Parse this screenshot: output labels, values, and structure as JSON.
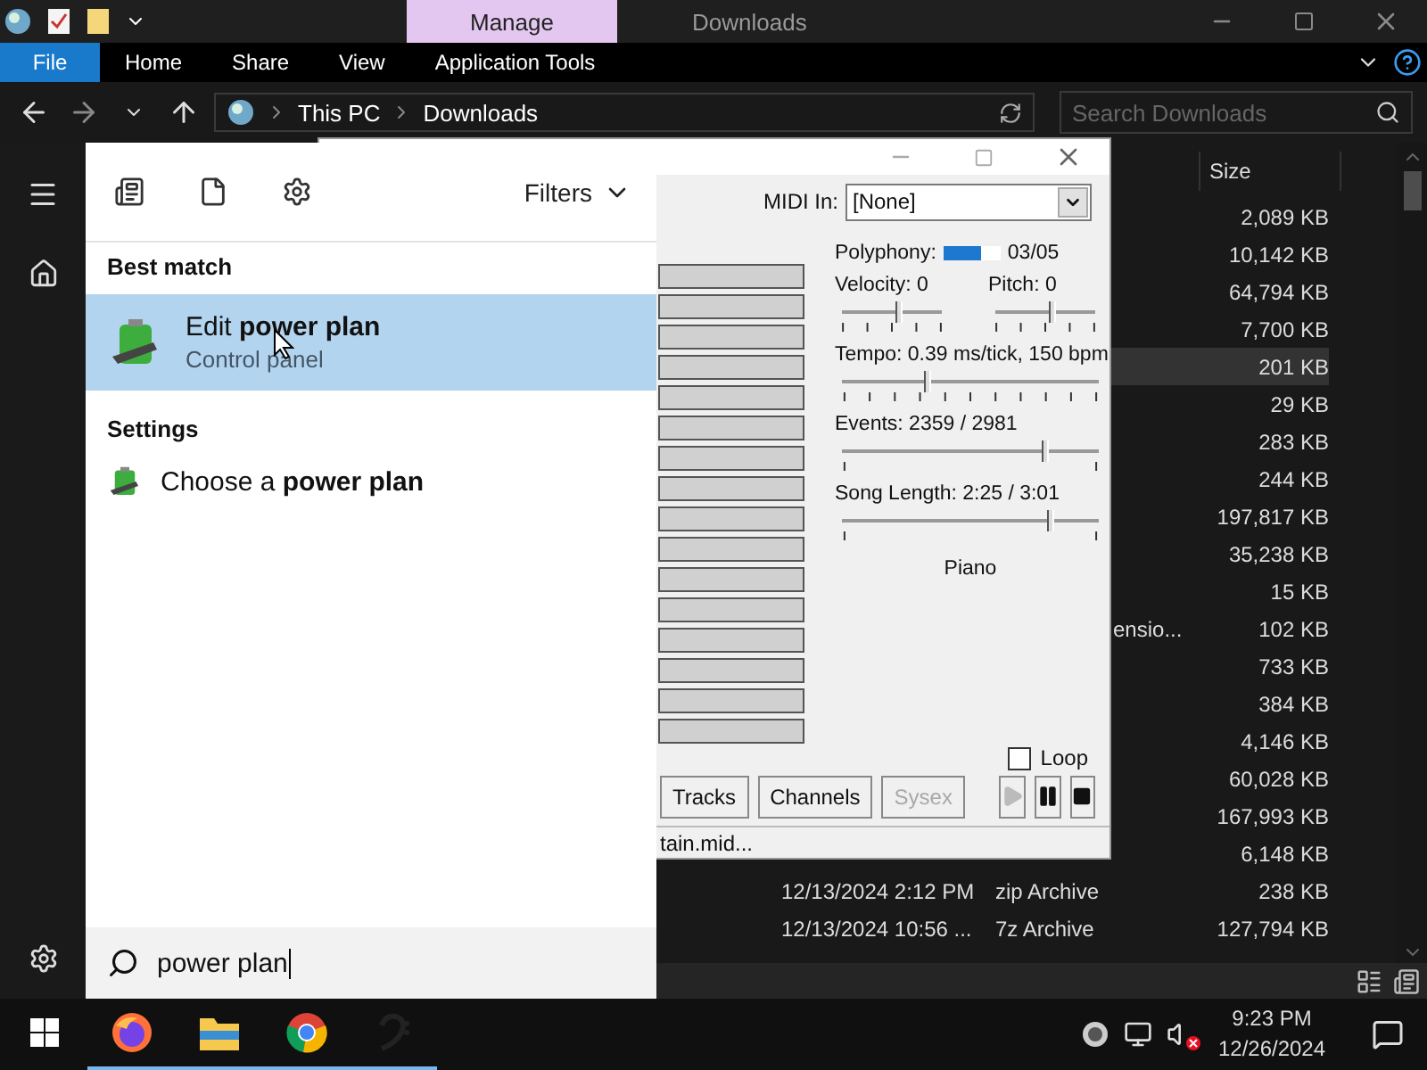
{
  "explorer": {
    "context_tab": "Manage",
    "title": "Downloads",
    "ribbon_tabs": [
      {
        "label": "File",
        "kind": "file"
      },
      {
        "label": "Home",
        "kind": "tab"
      },
      {
        "label": "Share",
        "kind": "tab"
      },
      {
        "label": "View",
        "kind": "tab"
      },
      {
        "label": "Application Tools",
        "kind": "tab"
      }
    ],
    "breadcrumbs": [
      "This PC",
      "Downloads"
    ],
    "search": {
      "placeholder": "Search Downloads"
    },
    "columns": [
      {
        "label": "Size"
      }
    ],
    "rows": [
      {
        "size": "2,089 KB",
        "selected": false
      },
      {
        "size": "10,142 KB",
        "selected": false
      },
      {
        "size": "64,794 KB",
        "selected": false
      },
      {
        "size": "7,700 KB",
        "selected": false
      },
      {
        "size": "201 KB",
        "selected": true
      },
      {
        "size": "29 KB",
        "selected": false
      },
      {
        "size": "283 KB",
        "selected": false
      },
      {
        "size": "244 KB",
        "selected": false
      },
      {
        "size": "197,817 KB",
        "selected": false
      },
      {
        "size": "35,238 KB",
        "selected": false
      },
      {
        "size": "15 KB",
        "selected": false
      },
      {
        "type": "ensio...",
        "size": "102 KB",
        "selected": false
      },
      {
        "size": "733 KB",
        "selected": false
      },
      {
        "size": "384 KB",
        "selected": false
      },
      {
        "size": "4,146 KB",
        "selected": false
      },
      {
        "size": "60,028 KB",
        "selected": false
      },
      {
        "size": "167,993 KB",
        "selected": false
      },
      {
        "size": "6,148 KB",
        "selected": false
      },
      {
        "date": "12/13/2024 2:12 PM",
        "type": "zip Archive",
        "size": "238 KB",
        "selected": false
      },
      {
        "date": "12/13/2024 10:56 ...",
        "type": "7z Archive",
        "size": "127,794 KB",
        "selected": false
      }
    ]
  },
  "midi_player": {
    "midi_in_label": "MIDI In:",
    "midi_in": "[None]",
    "polyphony": {
      "label": "Polyphony:",
      "level": 0.65,
      "reading": "03/05"
    },
    "sliders": [
      {
        "label": "Velocity: 0",
        "kind": "short",
        "level": 0.57
      },
      {
        "label": "Pitch: 0",
        "kind": "short",
        "level": 0.57
      },
      {
        "label": "Tempo: 0.39 ms/tick, 150 bpm",
        "kind": "ticked",
        "level": 0.33
      },
      {
        "label": "Events: 2359 / 2981",
        "kind": "plain",
        "level": 0.79
      },
      {
        "label": "Song Length: 2:25 / 3:01",
        "kind": "plain",
        "level": 0.81
      }
    ],
    "instrument": "Piano",
    "loop": {
      "label": "Loop",
      "checked": false
    },
    "tab_buttons": [
      {
        "label": "Tracks",
        "disabled": false
      },
      {
        "label": "Channels",
        "disabled": false
      },
      {
        "label": "Sysex",
        "disabled": true
      }
    ],
    "transport": [
      {
        "kind": "play",
        "disabled": true
      },
      {
        "kind": "pause",
        "disabled": false
      },
      {
        "kind": "stop",
        "disabled": false
      }
    ],
    "status": "tain.mid..."
  },
  "start_menu": {
    "filters": "Filters",
    "sections": [
      {
        "heading": "Best match",
        "items": [
          {
            "title": "Edit **power plan**",
            "subtitle": "Control panel",
            "selected": true
          }
        ]
      },
      {
        "heading": "Settings",
        "items": [
          {
            "title": "Choose a **power plan**",
            "selected": false
          }
        ]
      }
    ],
    "search": {
      "value": "power plan"
    }
  },
  "taskbar": {
    "apps": [
      {
        "kind": "firefox",
        "running": true
      },
      {
        "kind": "folder",
        "running": true
      },
      {
        "kind": "chrome",
        "running": true
      },
      {
        "kind": "clef",
        "running": true
      }
    ],
    "volume_muted": true,
    "time": "9:23 PM",
    "date": "12/26/2024"
  }
}
